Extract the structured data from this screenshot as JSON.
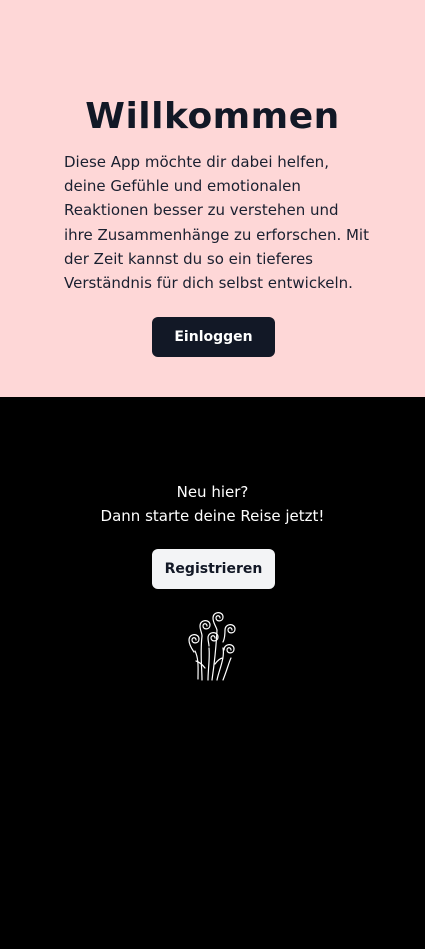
{
  "welcome": {
    "title": "Willkommen",
    "intro": "Diese App möchte dir dabei helfen, deine Gefühle und emotionalen Reaktionen besser zu verstehen und ihre Zusammenhänge zu erforschen. Mit der Zeit kannst du so ein tieferes Verständnis für dich selbst entwickeln.",
    "login_label": "Einloggen"
  },
  "signup": {
    "line1": "Neu hier?",
    "line2": "Dann starte deine Reise jetzt!",
    "register_label": "Registrieren"
  },
  "colors": {
    "top_background": "#fed7d7",
    "bottom_background": "#000000",
    "dark_button": "#121826",
    "light_button": "#f3f4f6"
  },
  "icons": {
    "decoration": "spiral-flowers-icon"
  }
}
